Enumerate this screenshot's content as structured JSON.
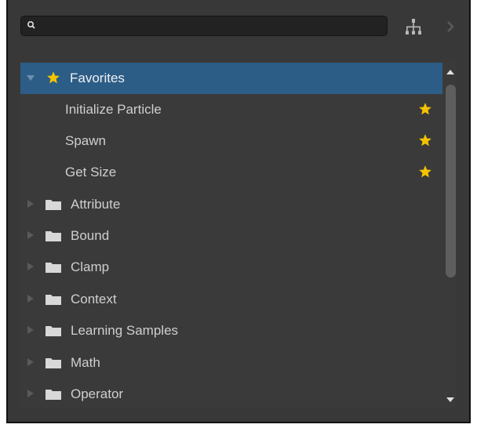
{
  "search": {
    "value": "",
    "placeholder": ""
  },
  "tree": {
    "favorites": {
      "label": "Favorites",
      "items": [
        {
          "label": "Initialize Particle"
        },
        {
          "label": "Spawn"
        },
        {
          "label": "Get Size"
        }
      ]
    },
    "folders": [
      {
        "label": "Attribute"
      },
      {
        "label": "Bound"
      },
      {
        "label": "Clamp"
      },
      {
        "label": "Context"
      },
      {
        "label": "Learning Samples"
      },
      {
        "label": "Math"
      },
      {
        "label": "Operator"
      }
    ]
  },
  "colors": {
    "panel_bg": "#383838",
    "selection": "#2c5d87",
    "star": "#f5c400",
    "text": "#cfcfcf"
  },
  "icons": {
    "search": "search-icon",
    "hierarchy": "hierarchy-icon",
    "collapse": "chevron-right-icon",
    "favorite": "star-icon",
    "folder": "folder-icon"
  }
}
